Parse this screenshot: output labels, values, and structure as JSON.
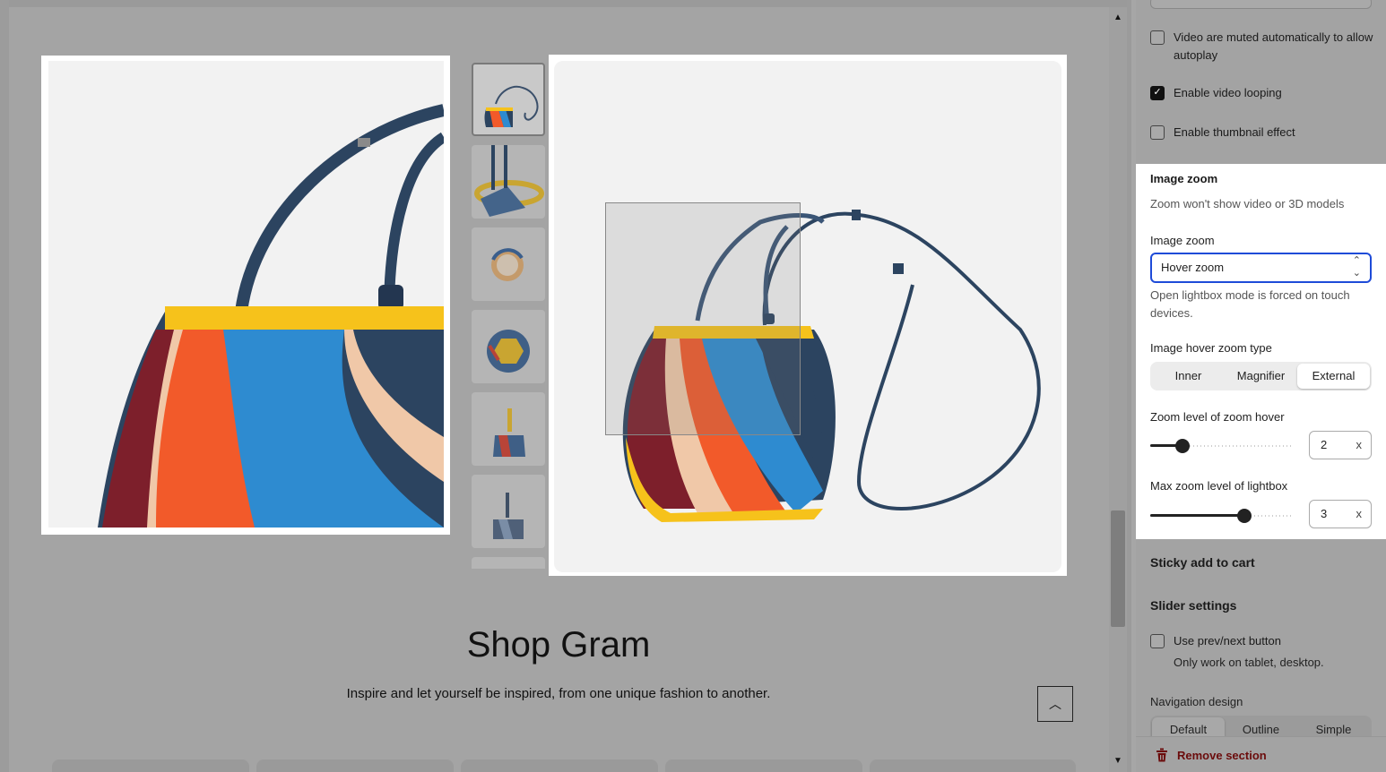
{
  "preview": {
    "section_title": "Shop Gram",
    "section_subtitle": "Inspire and let yourself be inspired, from one unique fashion to another."
  },
  "settings": {
    "video_muted_label": "Video are muted automatically to allow autoplay",
    "video_muted_checked": false,
    "video_loop_label": "Enable video looping",
    "video_loop_checked": true,
    "thumbnail_effect_label": "Enable thumbnail effect",
    "thumbnail_effect_checked": false,
    "image_zoom": {
      "heading": "Image zoom",
      "note": "Zoom won't show video or 3D models",
      "select_label": "Image zoom",
      "select_value": "Hover zoom",
      "helper": "Open lightbox mode is forced on touch devices.",
      "hover_type_label": "Image hover zoom type",
      "hover_types": [
        "Inner",
        "Magnifier",
        "External"
      ],
      "hover_type_selected": "External",
      "zoom_level_label": "Zoom level of zoom hover",
      "zoom_level_value": "2",
      "zoom_level_unit": "x",
      "max_zoom_label": "Max zoom level of lightbox",
      "max_zoom_value": "3",
      "max_zoom_unit": "x"
    },
    "sticky_cart_title": "Sticky add to cart",
    "slider_settings_title": "Slider settings",
    "prev_next_label": "Use prev/next button",
    "prev_next_checked": false,
    "prev_next_note": "Only work on tablet, desktop.",
    "navigation_design_label": "Navigation design",
    "navigation_designs": [
      "Default",
      "Outline",
      "Simple"
    ],
    "navigation_design_selected": "Default",
    "remove_section_label": "Remove section"
  },
  "colors": {
    "accent": "#1e4bd8",
    "danger": "#6b0c0c",
    "bag_orange": "#f25a2a",
    "bag_blue": "#2e8bd0",
    "bag_yellow": "#f6c21b",
    "bag_navy": "#2c4460",
    "bag_burgundy": "#7d1f2b",
    "bag_beige": "#f0c8a8"
  }
}
